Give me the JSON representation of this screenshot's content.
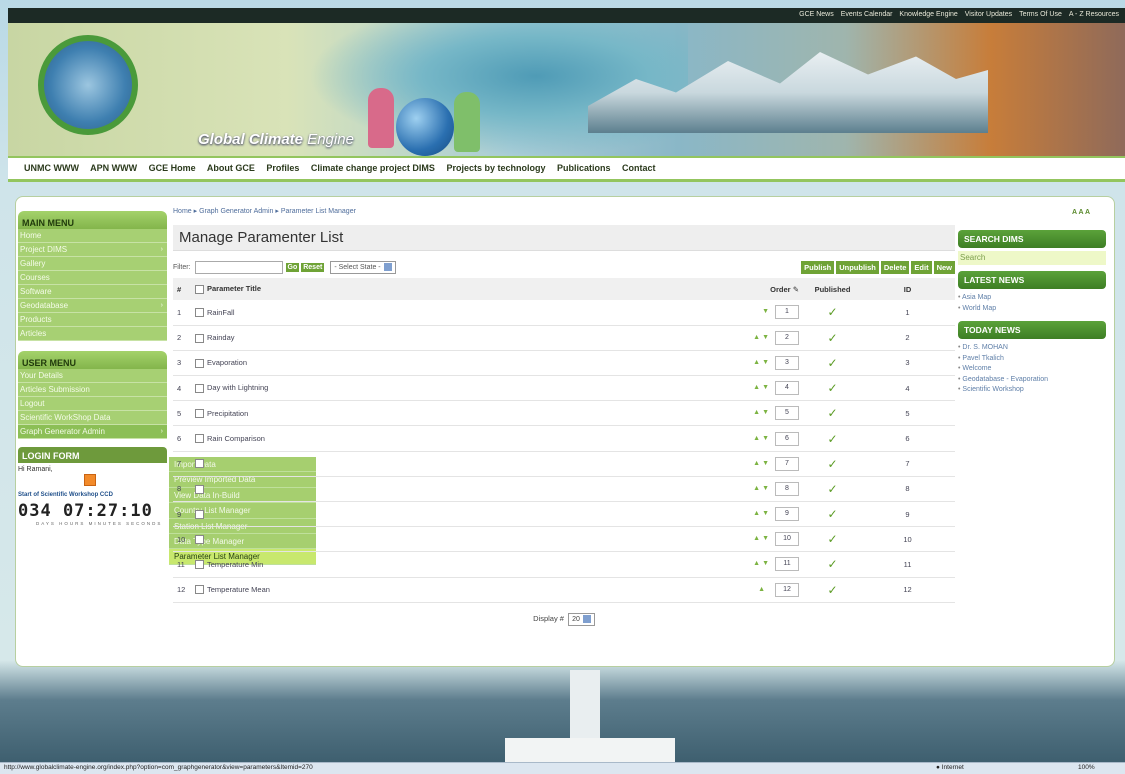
{
  "topbar": {
    "links": [
      "GCE News",
      "Events Calendar",
      "Knowledge Engine",
      "Visitor Updates",
      "Terms Of Use",
      "A - Z Resources"
    ]
  },
  "header": {
    "brand_bold": "Global Climate",
    "brand_light": "Engine"
  },
  "nav": {
    "items": [
      "UNMC WWW",
      "APN WWW",
      "GCE Home",
      "About GCE",
      "Profiles",
      "Climate change project DIMS",
      "Projects by technology",
      "Publications",
      "Contact"
    ]
  },
  "breadcrumb": {
    "home": "Home",
    "section": "Graph Generator Admin",
    "current": "Parameter List Manager"
  },
  "textsize": "A A A",
  "page_title": "Manage Paramenter List",
  "filter": {
    "label": "Filter:",
    "go": "Go",
    "reset": "Reset",
    "state_select": "- Select State -"
  },
  "actions": {
    "publish": "Publish",
    "unpublish": "Unpublish",
    "delete": "Delete",
    "edit": "Edit",
    "new": "New"
  },
  "table": {
    "col_num": "#",
    "col_title": "Parameter Title",
    "col_order": "Order",
    "col_published": "Published",
    "col_id": "ID",
    "rows": [
      {
        "n": "1",
        "title": "RainFall",
        "order": "1",
        "id": "1"
      },
      {
        "n": "2",
        "title": "Rainday",
        "order": "2",
        "id": "2"
      },
      {
        "n": "3",
        "title": "Evaporation",
        "order": "3",
        "id": "3"
      },
      {
        "n": "4",
        "title": "Day with Lightning",
        "order": "4",
        "id": "4"
      },
      {
        "n": "5",
        "title": "Precipitation",
        "order": "5",
        "id": "5"
      },
      {
        "n": "6",
        "title": "Rain Comparison",
        "order": "6",
        "id": "6"
      },
      {
        "n": "7",
        "title": "",
        "order": "7",
        "id": "7"
      },
      {
        "n": "8",
        "title": "",
        "order": "8",
        "id": "8"
      },
      {
        "n": "9",
        "title": "",
        "order": "9",
        "id": "9"
      },
      {
        "n": "10",
        "title": "",
        "order": "10",
        "id": "10"
      },
      {
        "n": "11",
        "title": "Temperature Min",
        "order": "11",
        "id": "11"
      },
      {
        "n": "12",
        "title": "Temperature Mean",
        "order": "12",
        "id": "12"
      }
    ]
  },
  "display": {
    "label": "Display #",
    "value": "20"
  },
  "main_menu": {
    "title": "MAIN MENU",
    "items": [
      "Home",
      "Project DIMS",
      "Gallery",
      "Courses",
      "Software",
      "Geodatabase",
      "Products",
      "Articles"
    ]
  },
  "user_menu": {
    "title": "USER MENU",
    "items": [
      "Your Details",
      "Articles Submission",
      "Logout",
      "Scientific WorkShop Data",
      "Graph Generator Admin"
    ]
  },
  "flyout": {
    "items": [
      "Import Data",
      "Preview Imported Data",
      "View Data In-Build",
      "Country List Manager",
      "Station List Manager",
      "Data Type Manager",
      "Parameter List Manager"
    ]
  },
  "login": {
    "title": "LOGIN FORM",
    "greeting": "Hi Ramani,",
    "countdown_title": "Start of Scientific Workshop CCD",
    "countdown": "034 07:27:10",
    "countdown_labels": "DAYS HOURS MINUTES SECONDS"
  },
  "right": {
    "search_title": "SEARCH DIMS",
    "search_placeholder": "Search",
    "latest_title": "LATEST NEWS",
    "latest": [
      "Asia Map",
      "World Map"
    ],
    "today_title": "TODAY NEWS",
    "today": [
      "Dr. S. MOHAN",
      "Pavel Tkalich",
      "Welcome",
      "Geodatabase - Evaporation",
      "Scientific Workshop"
    ]
  },
  "status": {
    "url": "http://www.globalclimate-engine.org/index.php?option=com_graphgenerator&view=parameters&Itemid=270",
    "zone": "Internet",
    "zoom": "100%"
  }
}
